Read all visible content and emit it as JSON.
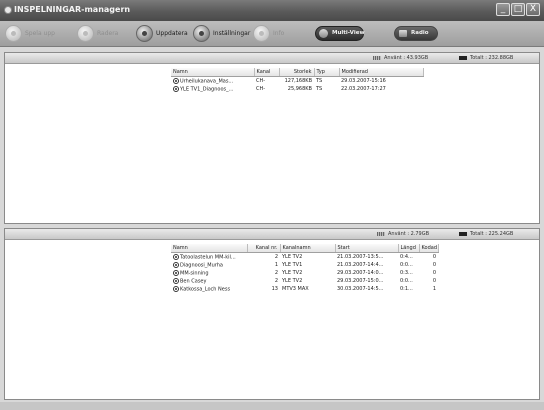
{
  "window": {
    "title": "INSPELNINGAR-managern",
    "buttons": [
      "_",
      "□",
      "X"
    ]
  },
  "toolbar": {
    "items": [
      {
        "label": "Spela upp",
        "icon": "play-icon",
        "enabled": false
      },
      {
        "label": "Radera",
        "icon": "delete-icon",
        "enabled": false
      },
      {
        "label": "Uppdatera",
        "icon": "refresh-icon",
        "enabled": true
      },
      {
        "label": "Inställningar",
        "icon": "settings-icon",
        "enabled": true
      },
      {
        "label": "Info",
        "icon": "info-icon",
        "enabled": false
      }
    ],
    "multiview_label": "Multi-View",
    "radio_label": "Radio"
  },
  "top_panel": {
    "free_label": "Använt : 43.93GB",
    "total_label": "Totalt : 232.88GB",
    "columns": [
      "Namn",
      "Kanal",
      "Storlek",
      "Typ",
      "Modifierad"
    ],
    "rows": [
      [
        "Urheilukanava_Mas...",
        "CH-",
        "127,168KB",
        "TS",
        "29.03.2007-15:16"
      ],
      [
        "YLE TV1_Diagnoos_...",
        "CH-",
        "25,968KB",
        "TS",
        "22.03.2007-17:27"
      ]
    ]
  },
  "bottom_panel": {
    "free_label": "Använt : 2.79GB",
    "total_label": "Totalt : 225.24GB",
    "columns": [
      "Namn",
      "Kanal nr.",
      "Kanalnamn",
      "Start",
      "Längd",
      "Kodad"
    ],
    "rows": [
      [
        "Tatoolastelun MM-kil...",
        "2",
        "YLE TV2",
        "21.03.2007-13:5...",
        "0:4...",
        "0"
      ],
      [
        "Diagnoosi_Murha",
        "1",
        "YLE TV1",
        "21.03.2007-14:4...",
        "0:0...",
        "0"
      ],
      [
        "MM-sinning",
        "2",
        "YLE TV2",
        "29.03.2007-14:0...",
        "0:3...",
        "0"
      ],
      [
        "Ben Casey",
        "2",
        "YLE TV2",
        "29.03.2007-15:0...",
        "0:0...",
        "0"
      ],
      [
        "Katkossa_Loch Ness",
        "13",
        "MTV3 MAX",
        "30.03.2007-14:5...",
        "0:1...",
        "1"
      ]
    ]
  }
}
